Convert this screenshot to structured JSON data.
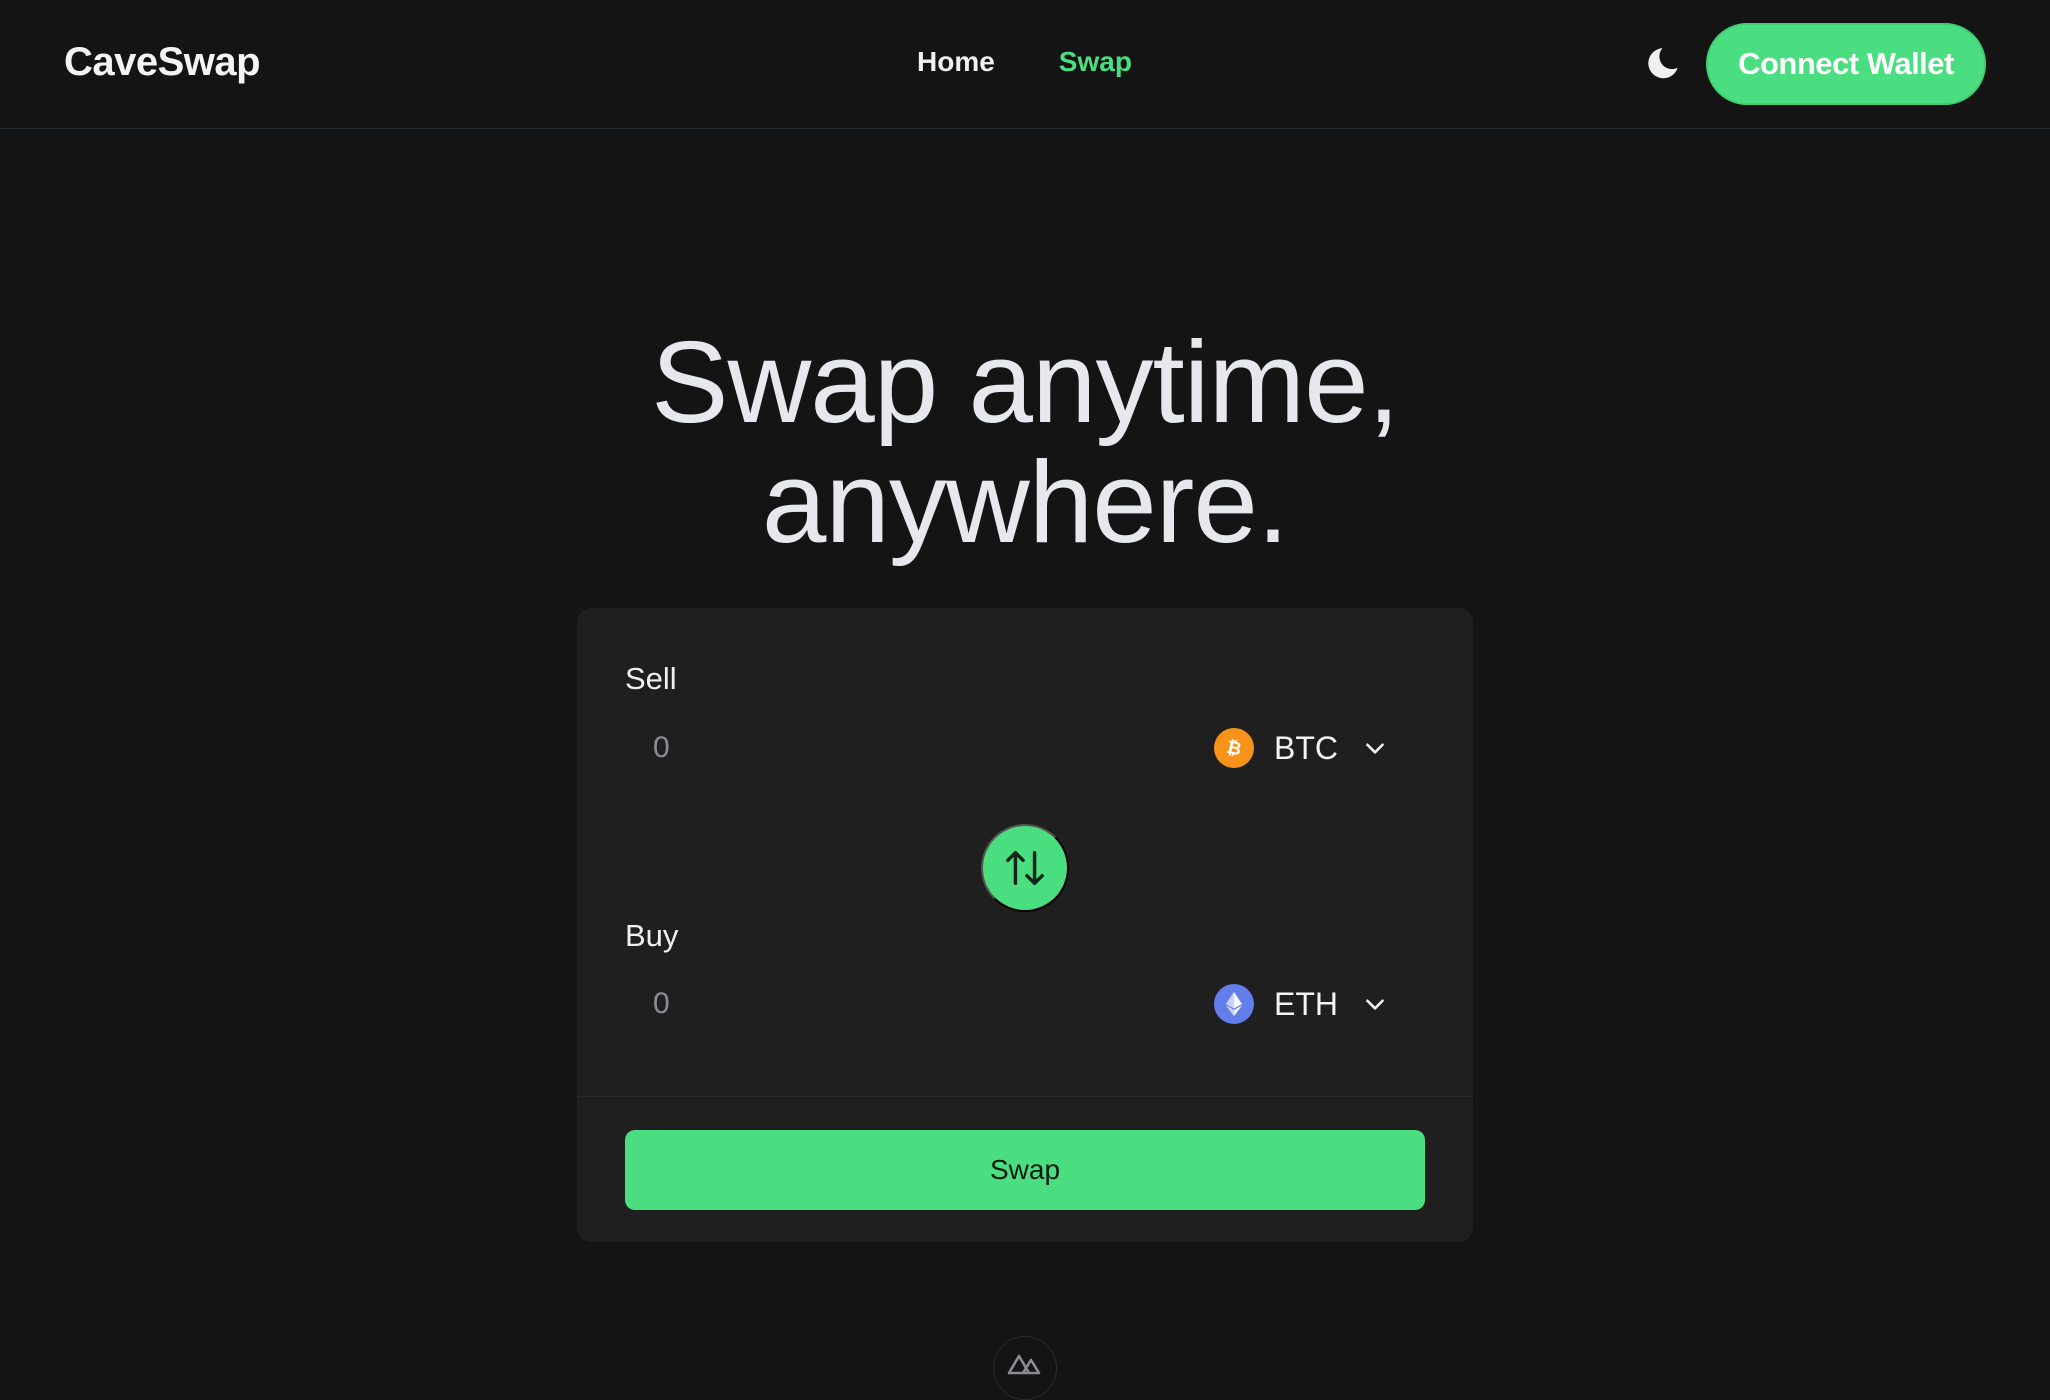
{
  "app": {
    "name": "CaveSwap"
  },
  "nav": {
    "items": [
      {
        "label": "Home",
        "active": false
      },
      {
        "label": "Swap",
        "active": true
      }
    ]
  },
  "header": {
    "theme_icon": "moon-icon",
    "connect_label": "Connect Wallet"
  },
  "hero": {
    "line1": "Swap anytime,",
    "line2": "anywhere."
  },
  "swap": {
    "sell": {
      "label": "Sell",
      "placeholder": "0",
      "value": "",
      "token": "BTC",
      "token_icon": "bitcoin-icon",
      "token_color": "#f7931a"
    },
    "buy": {
      "label": "Buy",
      "placeholder": "0",
      "value": "",
      "token": "ETH",
      "token_icon": "ethereum-icon",
      "token_color": "#627eea"
    },
    "switch_icon": "arrows-up-down-icon",
    "button_label": "Swap"
  },
  "footer": {
    "badge_icon": "nuxt-logo-icon"
  },
  "colors": {
    "accent": "#4ade80",
    "background": "#141414",
    "card": "#1f1f1f"
  }
}
